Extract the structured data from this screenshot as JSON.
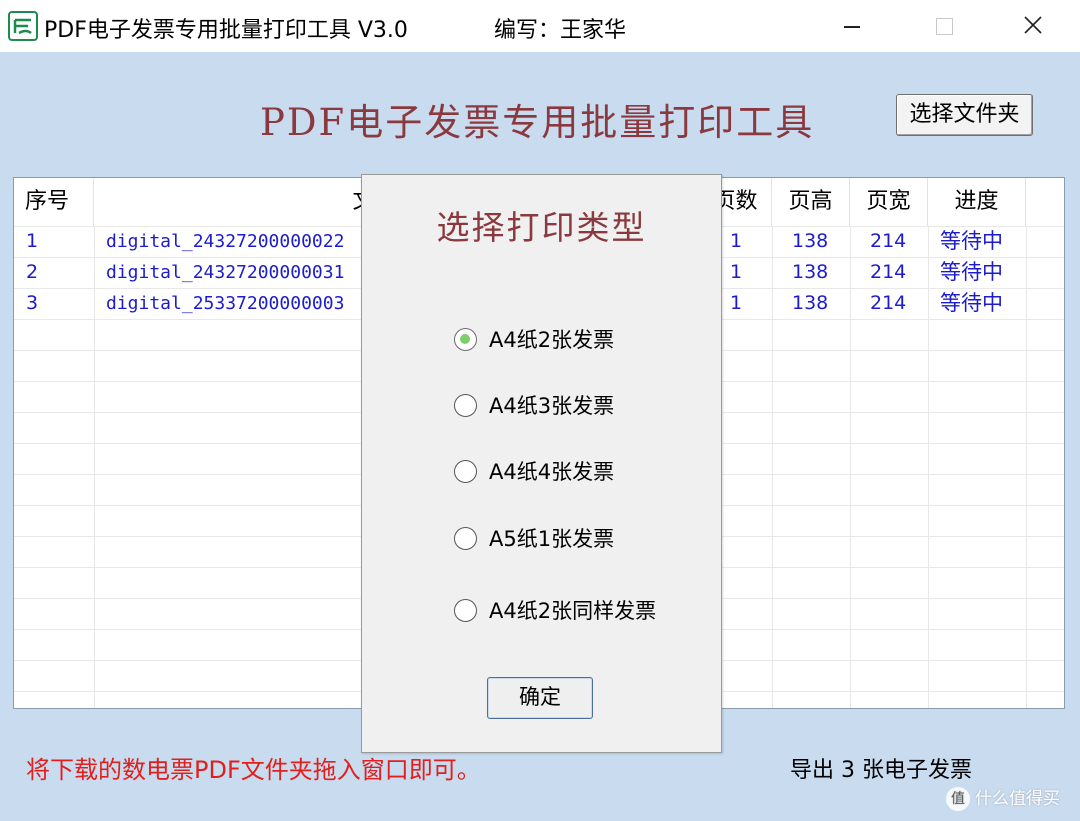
{
  "window": {
    "title": "PDF电子发票专用批量打印工具 V3.0",
    "author": "编写：王家华"
  },
  "header": {
    "title": "PDF电子发票专用批量打印工具",
    "select_folder_label": "选择文件夹"
  },
  "table": {
    "columns": [
      "序号",
      "文件名称",
      "页数",
      "页高",
      "页宽",
      "进度"
    ],
    "rows": [
      {
        "index": "1",
        "filename": "digital_24327200000022",
        "pages": "1",
        "height": "138",
        "width": "214",
        "status": "等待中"
      },
      {
        "index": "2",
        "filename": "digital_24327200000031",
        "pages": "1",
        "height": "138",
        "width": "214",
        "status": "等待中"
      },
      {
        "index": "3",
        "filename": "digital_25337200000003",
        "pages": "1",
        "height": "138",
        "width": "214",
        "status": "等待中"
      }
    ]
  },
  "dialog": {
    "title": "选择打印类型",
    "options": [
      {
        "label": "A4纸2张发票",
        "checked": true
      },
      {
        "label": "A4纸3张发票",
        "checked": false
      },
      {
        "label": "A4纸4张发票",
        "checked": false
      },
      {
        "label": "A5纸1张发票",
        "checked": false
      },
      {
        "label": "A4纸2张同样发票",
        "checked": false
      }
    ],
    "ok_label": "确定"
  },
  "footer": {
    "hint": "将下载的数电票PDF文件夹拖入窗口即可。",
    "export_status": "导出 3 张电子发票"
  },
  "watermark": {
    "badge": "值",
    "text": "什么值得买"
  },
  "colors": {
    "client_bg": "#c9dbef",
    "title_red": "#8a3a3e",
    "row_text": "#1c1ccc",
    "hint_red": "#e0201c"
  }
}
